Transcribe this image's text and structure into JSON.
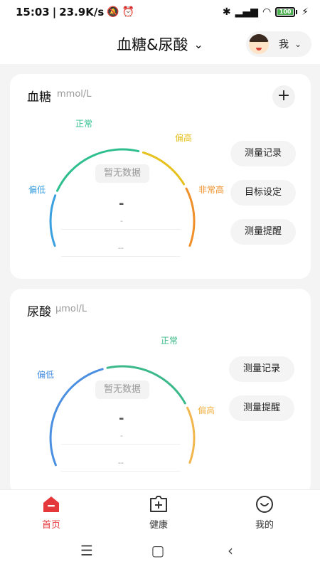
{
  "status_bar": {
    "time": "15:03",
    "network_speed": "23.9K/s",
    "battery": "100"
  },
  "header": {
    "title": "血糖&尿酸",
    "user_label": "我"
  },
  "blood_sugar": {
    "title": "血糖",
    "unit": "mmol/L",
    "no_data": "暂无数据",
    "value": "-",
    "sub_value": "-",
    "time": "--",
    "labels": {
      "low": "偏低",
      "normal": "正常",
      "high": "偏高",
      "very_high": "非常高"
    },
    "buttons": {
      "records": "测量记录",
      "goal": "目标设定",
      "reminder": "测量提醒"
    }
  },
  "uric_acid": {
    "title": "尿酸",
    "unit": "μmol/L",
    "no_data": "暂无数据",
    "value": "-",
    "sub_value": "-",
    "time": "--",
    "labels": {
      "low": "偏低",
      "normal": "正常",
      "high": "偏高"
    },
    "buttons": {
      "records": "测量记录",
      "reminder": "测量提醒"
    }
  },
  "bottom_nav": {
    "items": [
      {
        "label": "首页",
        "icon": "home-icon",
        "active": true
      },
      {
        "label": "健康",
        "icon": "health-icon",
        "active": false
      },
      {
        "label": "我的",
        "icon": "smile-icon",
        "active": false
      }
    ]
  },
  "colors": {
    "low": "#3aa0e0",
    "normal": "#2fbf8f",
    "high": "#e6c11e",
    "very_high": "#f0902a",
    "uric_low": "#4a8fe0",
    "uric_normal": "#3cb98a",
    "uric_high": "#f2b64e",
    "active_nav": "#e5383b"
  }
}
